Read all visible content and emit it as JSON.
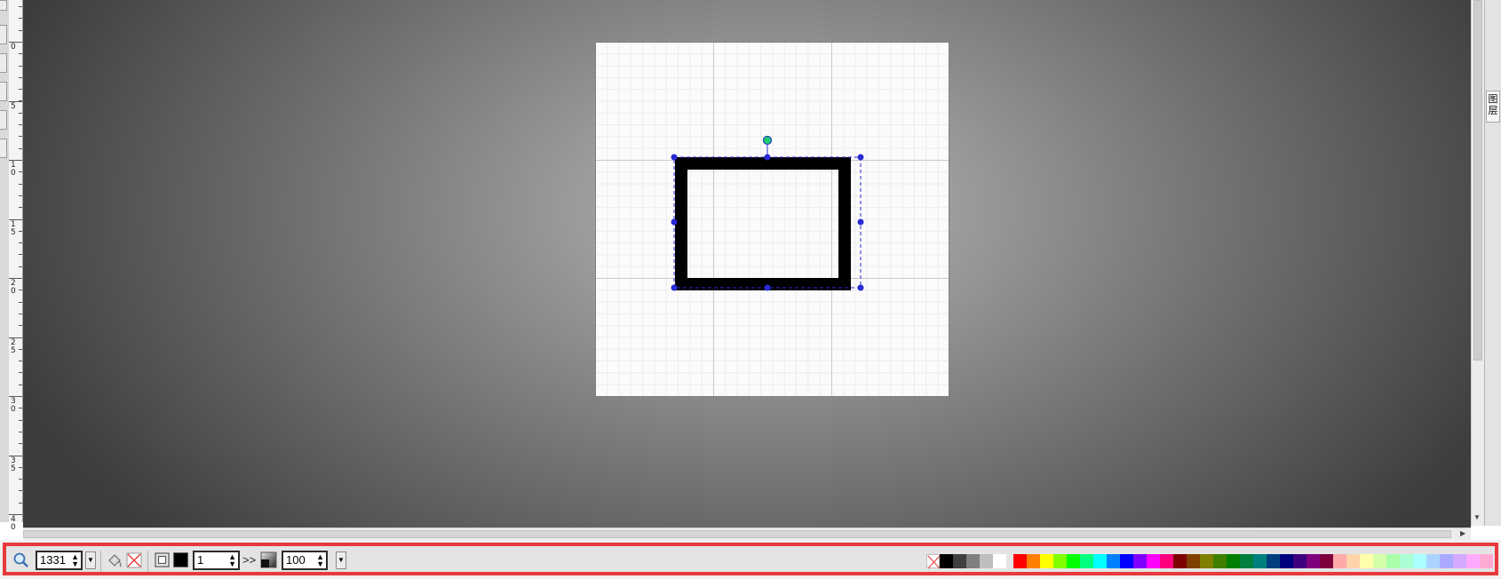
{
  "ruler": {
    "labels": [
      {
        "digits": [
          "0"
        ]
      },
      {
        "digits": [
          "5"
        ]
      },
      {
        "digits": [
          "1",
          "0"
        ]
      },
      {
        "digits": [
          "1",
          "5"
        ]
      },
      {
        "digits": [
          "2",
          "0"
        ]
      },
      {
        "digits": [
          "2",
          "5"
        ]
      },
      {
        "digits": [
          "3",
          "0"
        ]
      },
      {
        "digits": [
          "3",
          "5"
        ]
      },
      {
        "digits": [
          "4",
          "0"
        ]
      }
    ]
  },
  "right_panel": {
    "layers_tab": "图\n层"
  },
  "toolbar": {
    "zoom_value": "1331",
    "stroke_width": "1",
    "more_label": ">>",
    "opacity_value": "100",
    "stroke_color": "#000000",
    "highlight_border_color": "#e8393d"
  },
  "palette": {
    "no_color_swatch": "none",
    "colors": [
      "#000000",
      "#3f3f3f",
      "#7f7f7f",
      "#bfbfbf",
      "#ffffff",
      "#ff0000",
      "#ff7f00",
      "#ffff00",
      "#7fff00",
      "#00ff00",
      "#00ff7f",
      "#00ffff",
      "#007fff",
      "#0000ff",
      "#7f00ff",
      "#ff00ff",
      "#ff007f",
      "#7f0000",
      "#7f3f00",
      "#7f7f00",
      "#3f7f00",
      "#007f00",
      "#007f3f",
      "#007f7f",
      "#003f7f",
      "#00007f",
      "#3f007f",
      "#7f007f",
      "#7f003f",
      "#ffaaaa",
      "#ffd4aa",
      "#ffffaa",
      "#d4ffaa",
      "#aaffaa",
      "#aaffd4",
      "#aaffff",
      "#aad4ff",
      "#aaaaff",
      "#d4aaff",
      "#ffaaff",
      "#ffaad4"
    ]
  }
}
